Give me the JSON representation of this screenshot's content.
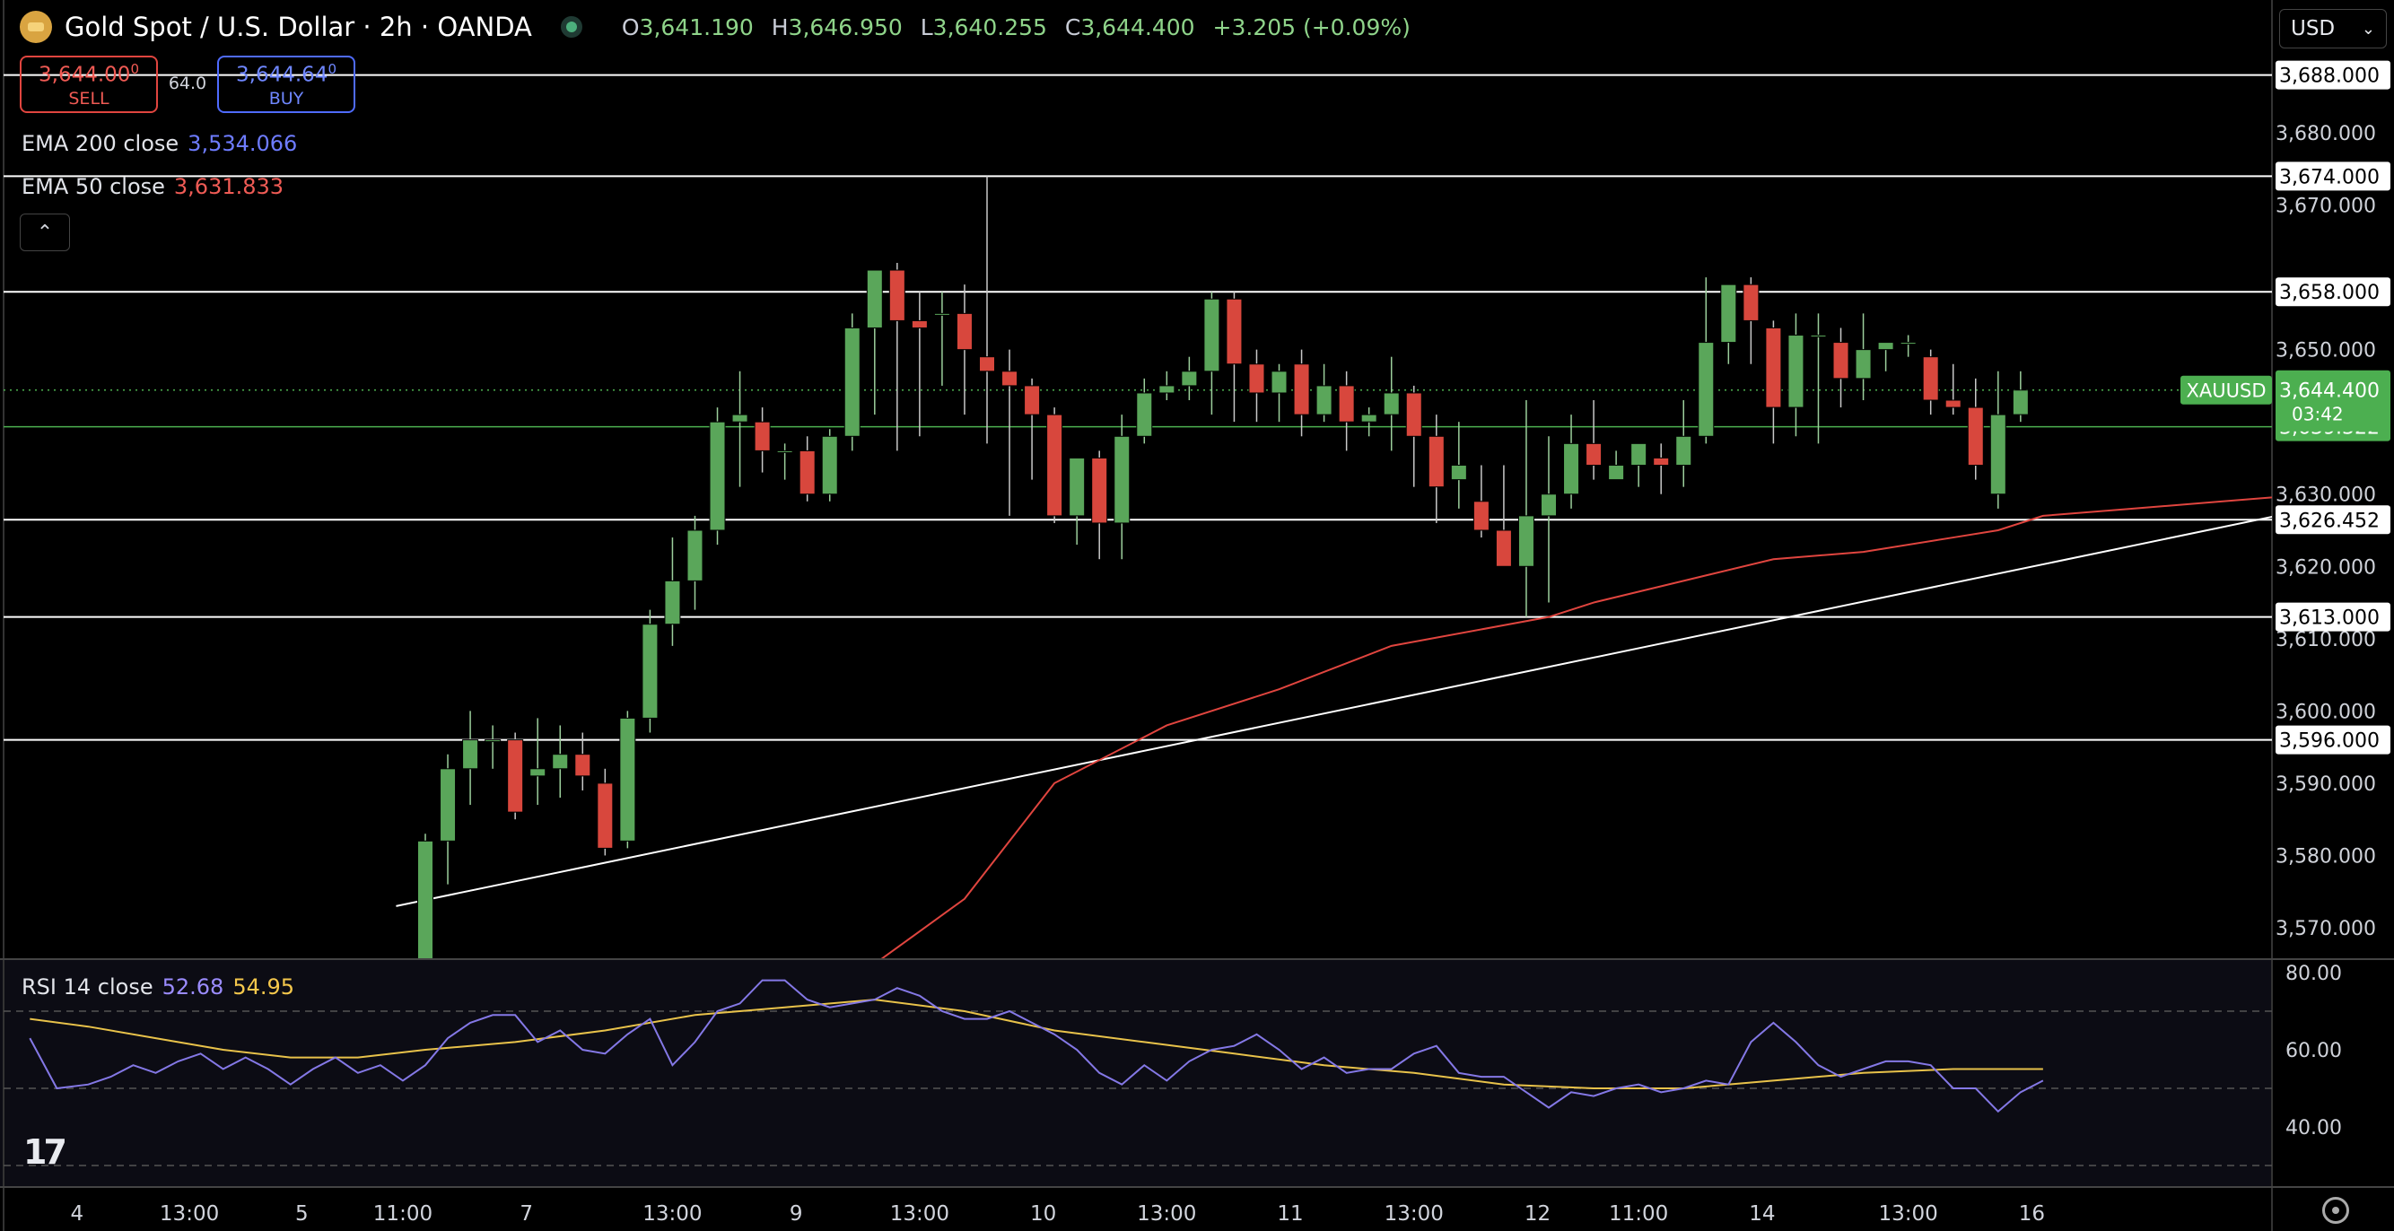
{
  "header": {
    "title": "Gold Spot / U.S. Dollar · 2h · OANDA",
    "open_label": "O",
    "open": "3,641.190",
    "high_label": "H",
    "high": "3,646.950",
    "low_label": "L",
    "low": "3,640.255",
    "close_label": "C",
    "close": "3,644.400",
    "change": "+3.205 (+0.09%)"
  },
  "trade": {
    "sell_price": "3,644.00",
    "sell_price_sup": "0",
    "sell_label": "SELL",
    "spread": "64.0",
    "buy_price": "3,644.64",
    "buy_price_sup": "0",
    "buy_label": "BUY"
  },
  "currency": "USD",
  "indicators": {
    "ema200": {
      "label": "EMA 200 close",
      "value": "3,534.066"
    },
    "ema50": {
      "label": "EMA 50 close",
      "value": "3,631.833"
    },
    "rsi": {
      "label": "RSI 14 close",
      "value": "52.68",
      "ma_value": "54.95"
    }
  },
  "colors": {
    "bg": "#000000",
    "up": "#5aa65a",
    "down": "#d8473d",
    "ema50": "#e0453f",
    "rsi": "#8478e6",
    "rsi_ma": "#e8c24a",
    "hline": "#ffffff",
    "price_tag": "#4caf50"
  },
  "chart_data": {
    "type": "candlestick",
    "title": "Gold Spot / U.S. Dollar · 2h · OANDA",
    "ylim": [
      3565,
      3692
    ],
    "y_ticks": [
      "3,570.000",
      "3,580.000",
      "3,590.000",
      "3,600.000",
      "3,610.000",
      "3,620.000",
      "3,630.000",
      "3,650.000",
      "3,670.000",
      "3,680.000"
    ],
    "x_ticks": [
      {
        "label": "4",
        "i": -15.5
      },
      {
        "label": "13:00",
        "i": -10.5
      },
      {
        "label": "5",
        "i": -5.5
      },
      {
        "label": "11:00",
        "i": -1
      },
      {
        "label": "7",
        "i": 4.5
      },
      {
        "label": "13:00",
        "i": 11
      },
      {
        "label": "9",
        "i": 16.5
      },
      {
        "label": "13:00",
        "i": 22
      },
      {
        "label": "10",
        "i": 27.5
      },
      {
        "label": "13:00",
        "i": 33
      },
      {
        "label": "11",
        "i": 38.5
      },
      {
        "label": "13:00",
        "i": 44
      },
      {
        "label": "12",
        "i": 49.5
      },
      {
        "label": "11:00",
        "i": 54
      },
      {
        "label": "14",
        "i": 59.5
      },
      {
        "label": "13:00",
        "i": 66
      },
      {
        "label": "16",
        "i": 71.5
      }
    ],
    "candles": [
      [
        3557,
        3583,
        3555,
        3582
      ],
      [
        3582,
        3594,
        3576,
        3592
      ],
      [
        3592,
        3600,
        3587,
        3596
      ],
      [
        3596,
        3598,
        3592,
        3596
      ],
      [
        3596,
        3597,
        3585,
        3586
      ],
      [
        3591,
        3599,
        3587,
        3592
      ],
      [
        3592,
        3598,
        3588,
        3594
      ],
      [
        3594,
        3597,
        3589,
        3591
      ],
      [
        3590,
        3592,
        3580,
        3581
      ],
      [
        3582,
        3600,
        3581,
        3599
      ],
      [
        3599,
        3614,
        3597,
        3612
      ],
      [
        3612,
        3624,
        3609,
        3618
      ],
      [
        3618,
        3627,
        3614,
        3625
      ],
      [
        3625,
        3642,
        3623,
        3640
      ],
      [
        3640,
        3647,
        3631,
        3641
      ],
      [
        3640,
        3642,
        3633,
        3636
      ],
      [
        3636,
        3637,
        3632,
        3636
      ],
      [
        3636,
        3638,
        3629,
        3630
      ],
      [
        3630,
        3639,
        3629,
        3638
      ],
      [
        3638,
        3655,
        3636,
        3653
      ],
      [
        3653,
        3660,
        3641,
        3661
      ],
      [
        3661,
        3662,
        3636,
        3654
      ],
      [
        3654,
        3658,
        3638,
        3653
      ],
      [
        3655,
        3658,
        3645,
        3655
      ],
      [
        3655,
        3659,
        3641,
        3650
      ],
      [
        3649,
        3674,
        3637,
        3647
      ],
      [
        3647,
        3650,
        3627,
        3645
      ],
      [
        3645,
        3646,
        3632,
        3641
      ],
      [
        3641,
        3642,
        3626,
        3627
      ],
      [
        3627,
        3635,
        3623,
        3635
      ],
      [
        3635,
        3636,
        3621,
        3626
      ],
      [
        3626,
        3641,
        3621,
        3638
      ],
      [
        3638,
        3646,
        3637,
        3644
      ],
      [
        3644,
        3647,
        3643,
        3645
      ],
      [
        3645,
        3649,
        3643,
        3647
      ],
      [
        3647,
        3658,
        3641,
        3657
      ],
      [
        3657,
        3658,
        3640,
        3648
      ],
      [
        3648,
        3650,
        3640,
        3644
      ],
      [
        3644,
        3648,
        3640,
        3647
      ],
      [
        3648,
        3650,
        3638,
        3641
      ],
      [
        3641,
        3648,
        3640,
        3645
      ],
      [
        3645,
        3647,
        3636,
        3640
      ],
      [
        3640,
        3642,
        3638,
        3641
      ],
      [
        3641,
        3649,
        3636,
        3644
      ],
      [
        3644,
        3645,
        3631,
        3638
      ],
      [
        3638,
        3641,
        3626,
        3631
      ],
      [
        3632,
        3640,
        3628,
        3634
      ],
      [
        3629,
        3634,
        3624,
        3625
      ],
      [
        3625,
        3634,
        3621,
        3620
      ],
      [
        3620,
        3643,
        3613,
        3627
      ],
      [
        3627,
        3638,
        3615,
        3630
      ],
      [
        3630,
        3641,
        3628,
        3637
      ],
      [
        3637,
        3643,
        3632,
        3634
      ],
      [
        3632,
        3636,
        3632,
        3634
      ],
      [
        3634,
        3637,
        3631,
        3637
      ],
      [
        3635,
        3637,
        3630,
        3634
      ],
      [
        3634,
        3643,
        3631,
        3638
      ],
      [
        3638,
        3660,
        3637,
        3651
      ],
      [
        3651,
        3658,
        3648,
        3659
      ],
      [
        3659,
        3660,
        3648,
        3654
      ],
      [
        3653,
        3654,
        3637,
        3642
      ],
      [
        3642,
        3655,
        3638,
        3652
      ],
      [
        3652,
        3655,
        3637,
        3652
      ],
      [
        3651,
        3653,
        3642,
        3646
      ],
      [
        3646,
        3655,
        3643,
        3650
      ],
      [
        3650,
        3651,
        3647,
        3651
      ],
      [
        3651,
        3652,
        3649,
        3651
      ],
      [
        3649,
        3650,
        3641,
        3643
      ],
      [
        3643,
        3648,
        3641,
        3642
      ],
      [
        3642,
        3646,
        3632,
        3634
      ],
      [
        3630,
        3647,
        3628,
        3641
      ],
      [
        3641,
        3647,
        3640,
        3644.4
      ]
    ],
    "ema50": [
      [
        20,
        3565
      ],
      [
        24,
        3574
      ],
      [
        28,
        3590
      ],
      [
        33,
        3598
      ],
      [
        38,
        3603
      ],
      [
        43,
        3609
      ],
      [
        50,
        3613
      ],
      [
        52,
        3615
      ],
      [
        56,
        3618
      ],
      [
        60,
        3621
      ],
      [
        64,
        3622
      ],
      [
        68,
        3624
      ],
      [
        70,
        3625
      ],
      [
        72,
        3627
      ],
      [
        76,
        3628
      ],
      [
        80,
        3629
      ],
      [
        84,
        3630
      ],
      [
        86,
        3631
      ],
      [
        88,
        3631.83
      ]
    ],
    "trendline": [
      [
        -1.3,
        3573
      ],
      [
        101,
        3639
      ]
    ],
    "hlines": [
      {
        "price": 3688,
        "label": "3,688.000"
      },
      {
        "price": 3674,
        "label": "3,674.000"
      },
      {
        "price": 3658,
        "label": "3,658.000"
      },
      {
        "price": 3626.452,
        "label": "3,626.452"
      },
      {
        "price": 3613,
        "label": "3,613.000"
      },
      {
        "price": 3596,
        "label": "3,596.000"
      }
    ],
    "green_line": {
      "price": 3639.322,
      "label": "3,639.322"
    },
    "current": {
      "price": 3644.4,
      "label": "3,644.400",
      "symbol": "XAUUSD",
      "countdown": "03:42"
    },
    "rsi": {
      "ylim": [
        32,
        82
      ],
      "ticks": [
        "80.00",
        "60.00",
        "40.00"
      ],
      "bands": [
        70,
        50,
        30
      ],
      "values": [
        [
          -17.6,
          63
        ],
        [
          -16.4,
          50
        ],
        [
          -15,
          51
        ],
        [
          -14,
          53
        ],
        [
          -13,
          56
        ],
        [
          -12,
          54
        ],
        [
          -11,
          57
        ],
        [
          -10,
          59
        ],
        [
          -9,
          55
        ],
        [
          -8,
          58
        ],
        [
          -7,
          55
        ],
        [
          -6,
          51
        ],
        [
          -5,
          55
        ],
        [
          -4,
          58
        ],
        [
          -3,
          54
        ],
        [
          -2,
          56
        ],
        [
          -1,
          52
        ],
        [
          0,
          56
        ],
        [
          1,
          63
        ],
        [
          2,
          67
        ],
        [
          3,
          69
        ],
        [
          4,
          69
        ],
        [
          5,
          62
        ],
        [
          6,
          65
        ],
        [
          7,
          60
        ],
        [
          8,
          59
        ],
        [
          9,
          64
        ],
        [
          10,
          68
        ],
        [
          11,
          56
        ],
        [
          12,
          62
        ],
        [
          13,
          70
        ],
        [
          14,
          72
        ],
        [
          15,
          78
        ],
        [
          16,
          78
        ],
        [
          17,
          73
        ],
        [
          18,
          71
        ],
        [
          19,
          72
        ],
        [
          20,
          73
        ],
        [
          21,
          76
        ],
        [
          22,
          74
        ],
        [
          23,
          70
        ],
        [
          24,
          68
        ],
        [
          25,
          68
        ],
        [
          26,
          70
        ],
        [
          27,
          67
        ],
        [
          28,
          64
        ],
        [
          29,
          60
        ],
        [
          30,
          54
        ],
        [
          31,
          51
        ],
        [
          32,
          56
        ],
        [
          33,
          52
        ],
        [
          34,
          57
        ],
        [
          35,
          60
        ],
        [
          36,
          61
        ],
        [
          37,
          64
        ],
        [
          38,
          60
        ],
        [
          39,
          55
        ],
        [
          40,
          58
        ],
        [
          41,
          54
        ],
        [
          42,
          55
        ],
        [
          43,
          55
        ],
        [
          44,
          59
        ],
        [
          45,
          61
        ],
        [
          46,
          54
        ],
        [
          47,
          53
        ],
        [
          48,
          53
        ],
        [
          49,
          49
        ],
        [
          50,
          45
        ],
        [
          51,
          49
        ],
        [
          52,
          48
        ],
        [
          53,
          50
        ],
        [
          54,
          51
        ],
        [
          55,
          49
        ],
        [
          56,
          50
        ],
        [
          57,
          52
        ],
        [
          58,
          51
        ],
        [
          59,
          62
        ],
        [
          60,
          67
        ],
        [
          61,
          62
        ],
        [
          62,
          56
        ],
        [
          63,
          53
        ],
        [
          64,
          55
        ],
        [
          65,
          57
        ],
        [
          66,
          57
        ],
        [
          67,
          56
        ],
        [
          68,
          50
        ],
        [
          69,
          50
        ],
        [
          70,
          44
        ],
        [
          71,
          49
        ],
        [
          72,
          52
        ]
      ],
      "ma": [
        [
          -17.6,
          68
        ],
        [
          -15,
          66
        ],
        [
          -12,
          63
        ],
        [
          -9,
          60
        ],
        [
          -6,
          58
        ],
        [
          -3,
          58
        ],
        [
          0,
          60
        ],
        [
          4,
          62
        ],
        [
          8,
          65
        ],
        [
          12,
          69
        ],
        [
          16,
          71
        ],
        [
          20,
          73
        ],
        [
          24,
          70
        ],
        [
          28,
          65
        ],
        [
          32,
          62
        ],
        [
          36,
          59
        ],
        [
          40,
          56
        ],
        [
          44,
          54
        ],
        [
          48,
          51
        ],
        [
          52,
          50
        ],
        [
          56,
          50
        ],
        [
          60,
          52
        ],
        [
          64,
          54
        ],
        [
          68,
          55
        ],
        [
          72,
          55
        ]
      ]
    }
  }
}
